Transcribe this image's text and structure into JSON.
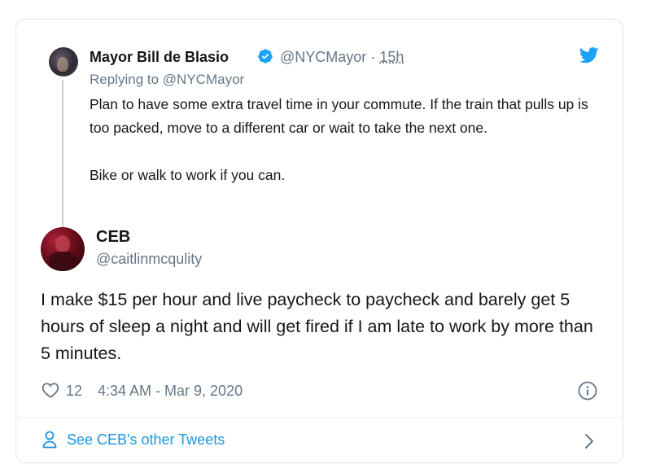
{
  "quoted_tweet": {
    "author_name": "Mayor Bill de Blasio",
    "handle": "@NYCMayor",
    "separator": "·",
    "time": "15h",
    "replying_prefix": "Replying to",
    "replying_to": "@NYCMayor",
    "paragraphs": [
      "Plan to have some extra travel time in your commute. If the train that pulls up is too packed, move to a different car or wait to take the next one.",
      "Bike or walk to work if you can."
    ]
  },
  "tweet": {
    "author_name": "CEB",
    "handle": "@caitlinmcqulity",
    "text": "I make $15 per hour and live paycheck to paycheck and barely get 5 hours of sleep a night and will get fired if I am late to work by more than 5 minutes.",
    "like_count": "12",
    "timestamp": "4:34 AM - Mar 9, 2020"
  },
  "footer": {
    "see_more": "See CEB's other Tweets"
  },
  "colors": {
    "accent": "#1b95e0",
    "muted": "#657786",
    "text": "#14171a",
    "verified": "#1da1f2",
    "border": "#dfe3e8"
  },
  "icons": [
    "verified-badge-icon",
    "twitter-bird-icon",
    "heart-icon",
    "info-icon",
    "person-icon",
    "chevron-right-icon"
  ]
}
